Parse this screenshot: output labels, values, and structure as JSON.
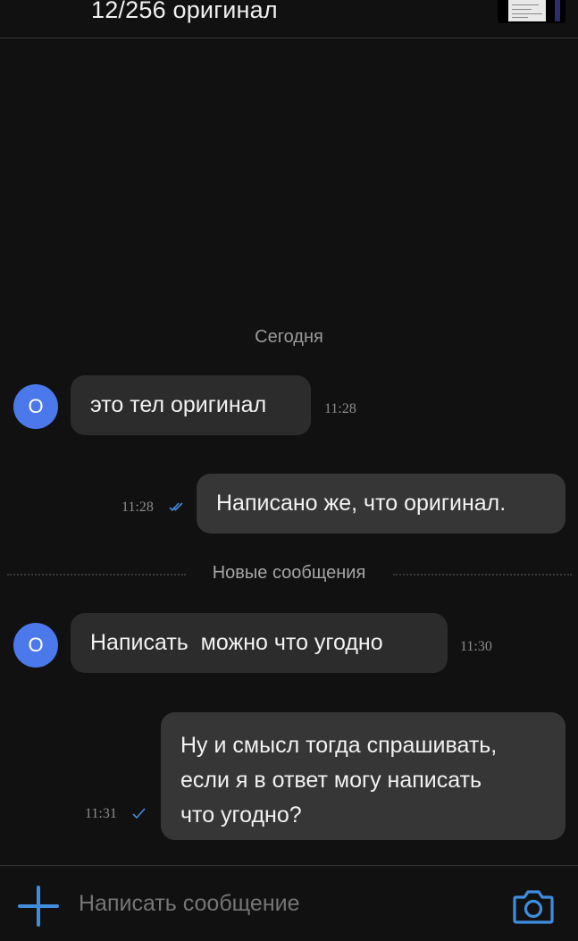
{
  "header": {
    "title": "12/256 оригинал"
  },
  "date_separator": "Сегодня",
  "new_messages_label": "Новые сообщения",
  "contact": {
    "avatar_letter": "О",
    "avatar_color": "#4b78ea"
  },
  "messages": [
    {
      "direction": "in",
      "text": "это тел оригинал",
      "time": "11:28"
    },
    {
      "direction": "out",
      "text": "Написано же, что оригинал.",
      "time": "11:28",
      "status": "read"
    },
    {
      "direction": "in",
      "text": "Написать  можно что угодно",
      "time": "11:30"
    },
    {
      "direction": "out",
      "lines": [
        "Ну и смысл тогда спрашивать,",
        "если я в ответ могу написать",
        "что угодно?"
      ],
      "time": "11:31",
      "status": "sent"
    }
  ],
  "composer": {
    "placeholder": "Написать сообщение",
    "attach_icon": "plus-icon",
    "camera_icon": "camera-icon"
  },
  "colors": {
    "background": "#111111",
    "bubble_incoming": "#2c2c2c",
    "bubble_outgoing": "#363636",
    "accent": "#3f8ede"
  }
}
